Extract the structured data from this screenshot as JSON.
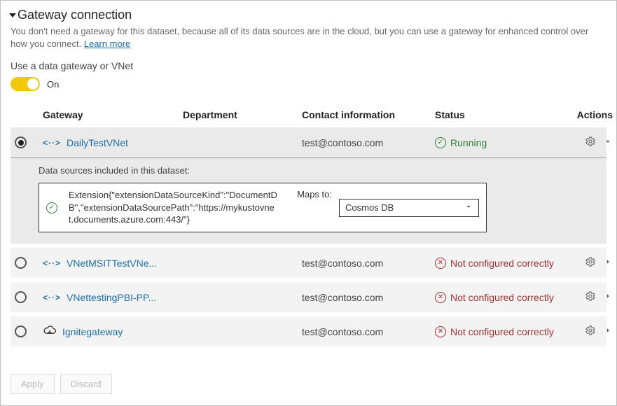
{
  "header": {
    "title": "Gateway connection",
    "description": "You don't need a gateway for this dataset, because all of its data sources are in the cloud, but you can use a gateway for enhanced control over how you connect.",
    "learn_more": "Learn more"
  },
  "toggle": {
    "label": "Use a data gateway or VNet",
    "state_text": "On",
    "on": true
  },
  "columns": {
    "gateway": "Gateway",
    "department": "Department",
    "contact": "Contact information",
    "status": "Status",
    "actions": "Actions"
  },
  "status_labels": {
    "running": "Running",
    "not_configured": "Not configured correctly"
  },
  "gateways": [
    {
      "name": "DailyTestVNet",
      "department": "",
      "contact": "test@contoso.com",
      "status": "running",
      "type": "vnet",
      "selected": true,
      "expanded": true
    },
    {
      "name": "VNetMSITTestVNe...",
      "department": "",
      "contact": "test@contoso.com",
      "status": "not_configured",
      "type": "vnet",
      "selected": false,
      "expanded": false
    },
    {
      "name": "VNettestingPBI-PP...",
      "department": "",
      "contact": "test@contoso.com",
      "status": "not_configured",
      "type": "vnet",
      "selected": false,
      "expanded": false
    },
    {
      "name": "Ignitegateway",
      "department": "",
      "contact": "test@contoso.com",
      "status": "not_configured",
      "type": "onprem",
      "selected": false,
      "expanded": false
    }
  ],
  "expand": {
    "title": "Data sources included in this dataset:",
    "source_text": "Extension{\"extensionDataSourceKind\":\"DocumentDB\",\"extensionDataSourcePath\":\"https://mykustovnet.documents.azure.com:443/\"}",
    "maps_label": "Maps to:",
    "dropdown_value": "Cosmos DB"
  },
  "buttons": {
    "apply": "Apply",
    "discard": "Discard"
  }
}
